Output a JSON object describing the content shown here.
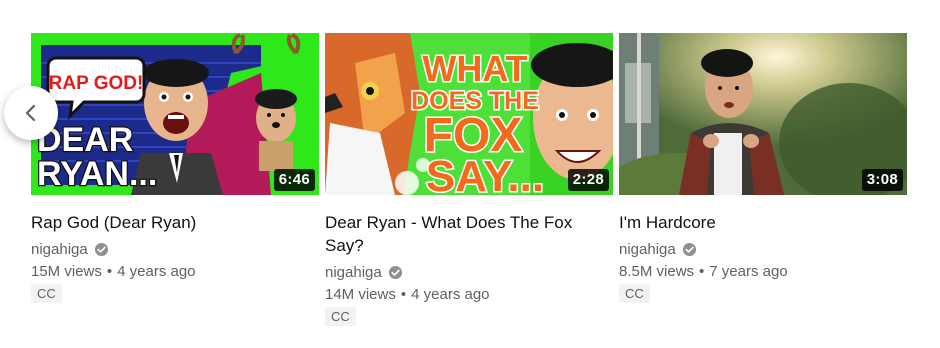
{
  "shelf": {
    "prev_button_icon": "chevron-left-icon",
    "videos": [
      {
        "title": "Rap God (Dear Ryan)",
        "channel": "nigahiga",
        "verified": true,
        "views": "15M views",
        "age": "4 years ago",
        "badge": "CC",
        "duration": "6:46",
        "thumb_text": {
          "bubble": "RAP GOD!",
          "line1": "DEAR",
          "line2": "RYAN..."
        }
      },
      {
        "title": "Dear Ryan - What Does The Fox Say?",
        "channel": "nigahiga",
        "verified": true,
        "views": "14M views",
        "age": "4 years ago",
        "badge": "CC",
        "duration": "2:28",
        "thumb_text": {
          "line1": "WHAT",
          "line2": "DOES THE",
          "line3": "FOX",
          "line4": "SAY..."
        }
      },
      {
        "title": "I'm Hardcore",
        "channel": "nigahiga",
        "verified": true,
        "views": "8.5M views",
        "age": "7 years ago",
        "badge": "CC",
        "duration": "3:08"
      }
    ]
  },
  "colors": {
    "title_text": "#111111",
    "meta_text": "#606060",
    "badge_bg": "#f2f2f2",
    "thumb1_green": "#2ee81a",
    "thumb2_orange": "#f26b1d",
    "thumb3_foliage": "#4f6b3a"
  }
}
